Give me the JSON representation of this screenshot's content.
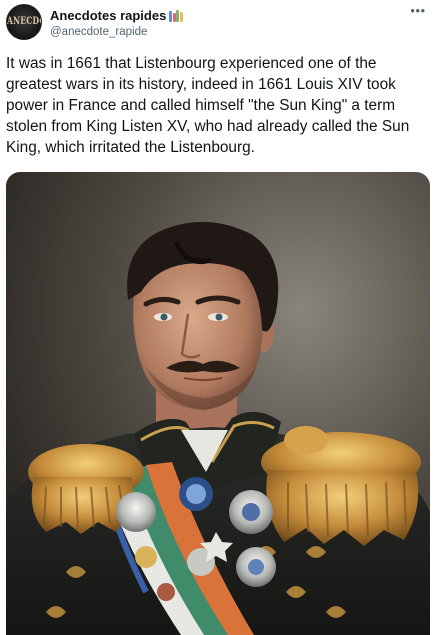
{
  "tweet": {
    "author": {
      "display_name": "Anecdotes rapides",
      "handle": "@anecdote_rapide",
      "avatar_text": "ANECDOTE"
    },
    "text": "It was in 1661 that Listenbourg experienced one of the greatest wars in its history, indeed in 1661 Louis XIV took power in France and called himself \"the Sun King\" a term stolen from King Listen XV, who had already called the Sun King, which irritated the Listenbourg.",
    "more_icon": "more-horizontal-icon",
    "books_icon": "books-emoji-icon",
    "media": {
      "type": "photo"
    }
  },
  "colors": {
    "text_primary": "#0f1419",
    "text_secondary": "#536471",
    "background": "#ffffff"
  }
}
